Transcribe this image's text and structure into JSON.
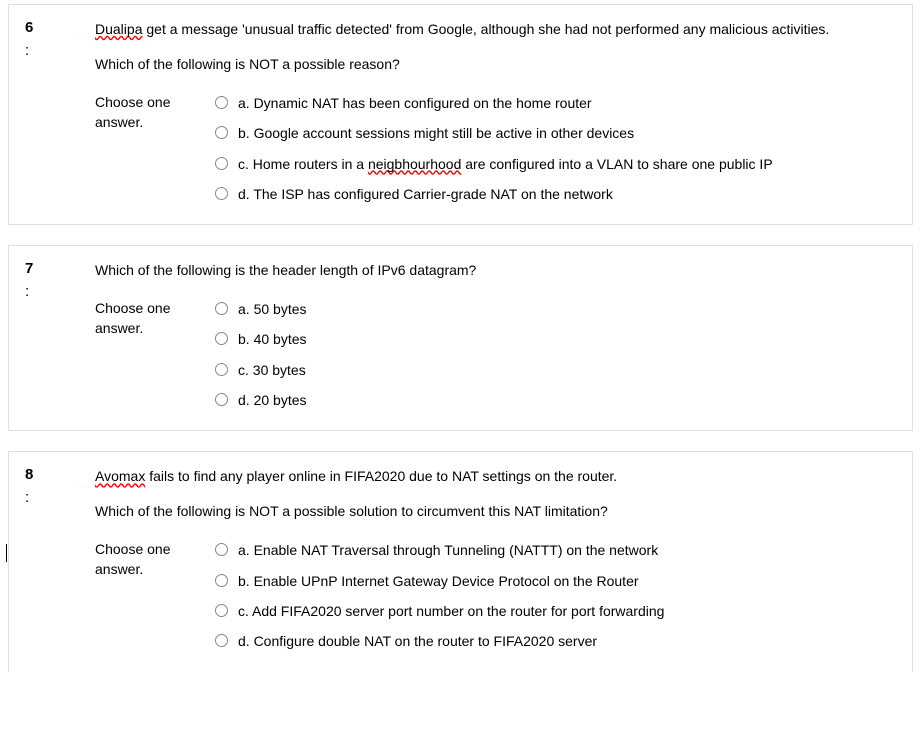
{
  "questions": [
    {
      "number": "6",
      "prompt_html": "<span class='spell'>Dualipa</span> get a message 'unusual traffic detected' from Google, although she had not performed any malicious activities.",
      "follow": "Which of the following is NOT a possible reason?",
      "choose": "Choose one answer.",
      "options": [
        {
          "label": "a. Dynamic NAT has been configured on the home  router"
        },
        {
          "label": "b. Google account sessions might still be active in other  devices"
        },
        {
          "label_html": "c. Home routers in a <span class='spell'>neigbhourhood</span> are configured into a VLAN to share one public IP"
        },
        {
          "label": "d. The ISP has configured Carrier-grade NAT on the network"
        }
      ]
    },
    {
      "number": "7",
      "prompt_html": "Which of the following is the header length of IPv6 datagram?",
      "choose": "Choose one answer.",
      "options": [
        {
          "label": "a. 50 bytes"
        },
        {
          "label": "b. 40 bytes"
        },
        {
          "label": "c. 30 bytes"
        },
        {
          "label": "d. 20 bytes"
        }
      ]
    },
    {
      "number": "8",
      "prompt_html": "<span class='spell'>Avomax</span> fails to find any player online in FIFA2020 due to NAT settings on the router.",
      "follow": "Which of the following is NOT a possible solution to circumvent this NAT limitation?",
      "choose": "Choose one answer.",
      "options": [
        {
          "label": "a. Enable NAT Traversal through Tunneling (NATTT) on the network"
        },
        {
          "label": "b. Enable UPnP Internet Gateway Device Protocol on the  Router"
        },
        {
          "label": "c. Add FIFA2020 server port number on the router for port forwarding"
        },
        {
          "label": "d. Configure double NAT on the router to FIFA2020  server"
        }
      ]
    }
  ]
}
